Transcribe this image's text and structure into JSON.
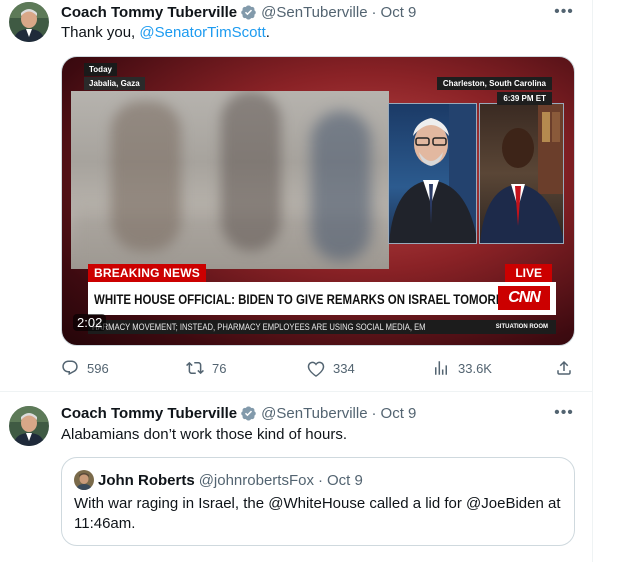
{
  "colors": {
    "accent": "#1d9bf0",
    "secondary_text": "#536471",
    "primary_text": "#0f1419",
    "breaking_red": "#cc0000"
  },
  "tweets": [
    {
      "author_name": "Coach Tommy Tuberville",
      "handle": "@SenTuberville",
      "separator": "·",
      "date": "Oct 9",
      "text_before": "Thank you, ",
      "mention": "@SenatorTimScott",
      "text_after": ".",
      "media": {
        "today_label": "Today",
        "place_label": "Jabalia, Gaza",
        "location_label": "Charleston, South Carolina",
        "time_label": "6:39 PM ET",
        "breaking_label": "BREAKING NEWS",
        "live_label": "LIVE",
        "headline": "WHITE HOUSE OFFICIAL: BIDEN TO GIVE REMARKS ON ISRAEL TOMORROW",
        "network_logo": "CNN",
        "ticker": "HARMACY MOVEMENT; INSTEAD, PHARMACY EMPLOYEES ARE USING SOCIAL MEDIA, EM",
        "show_label": "SITUATION ROOM",
        "duration": "2:02"
      },
      "actions": {
        "replies": "596",
        "reposts": "76",
        "likes": "334",
        "views": "33.6K"
      }
    },
    {
      "author_name": "Coach Tommy Tuberville",
      "handle": "@SenTuberville",
      "separator": "·",
      "date": "Oct 9",
      "text": "Alabamians don’t work those kind of hours.",
      "quote": {
        "author_name": "John Roberts",
        "handle": "@johnrobertsFox",
        "separator": "·",
        "date": "Oct 9",
        "text": "With war raging in Israel, the @WhiteHouse called a lid for @JoeBiden at 11:46am."
      }
    }
  ]
}
